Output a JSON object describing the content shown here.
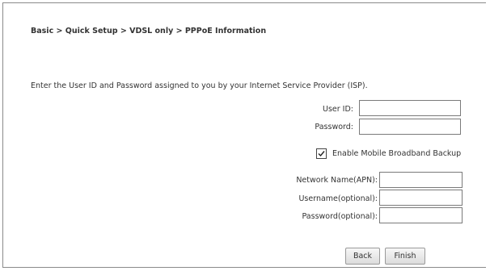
{
  "breadcrumb": "Basic > Quick Setup > VDSL only > PPPoE Information",
  "instructions": "Enter the User ID and Password assigned to you by your Internet Service Provider (ISP).",
  "credentials": {
    "user_id_label": "User ID:",
    "user_id_value": "",
    "password_label": "Password:",
    "password_value": ""
  },
  "backup": {
    "enable_label": "Enable Mobile Broadband Backup",
    "enabled": true,
    "apn_label": "Network Name(APN):",
    "apn_value": "",
    "username_label": "Username(optional):",
    "username_value": "",
    "password_label": "Password(optional):",
    "password_value": ""
  },
  "buttons": {
    "back": "Back",
    "finish": "Finish"
  }
}
